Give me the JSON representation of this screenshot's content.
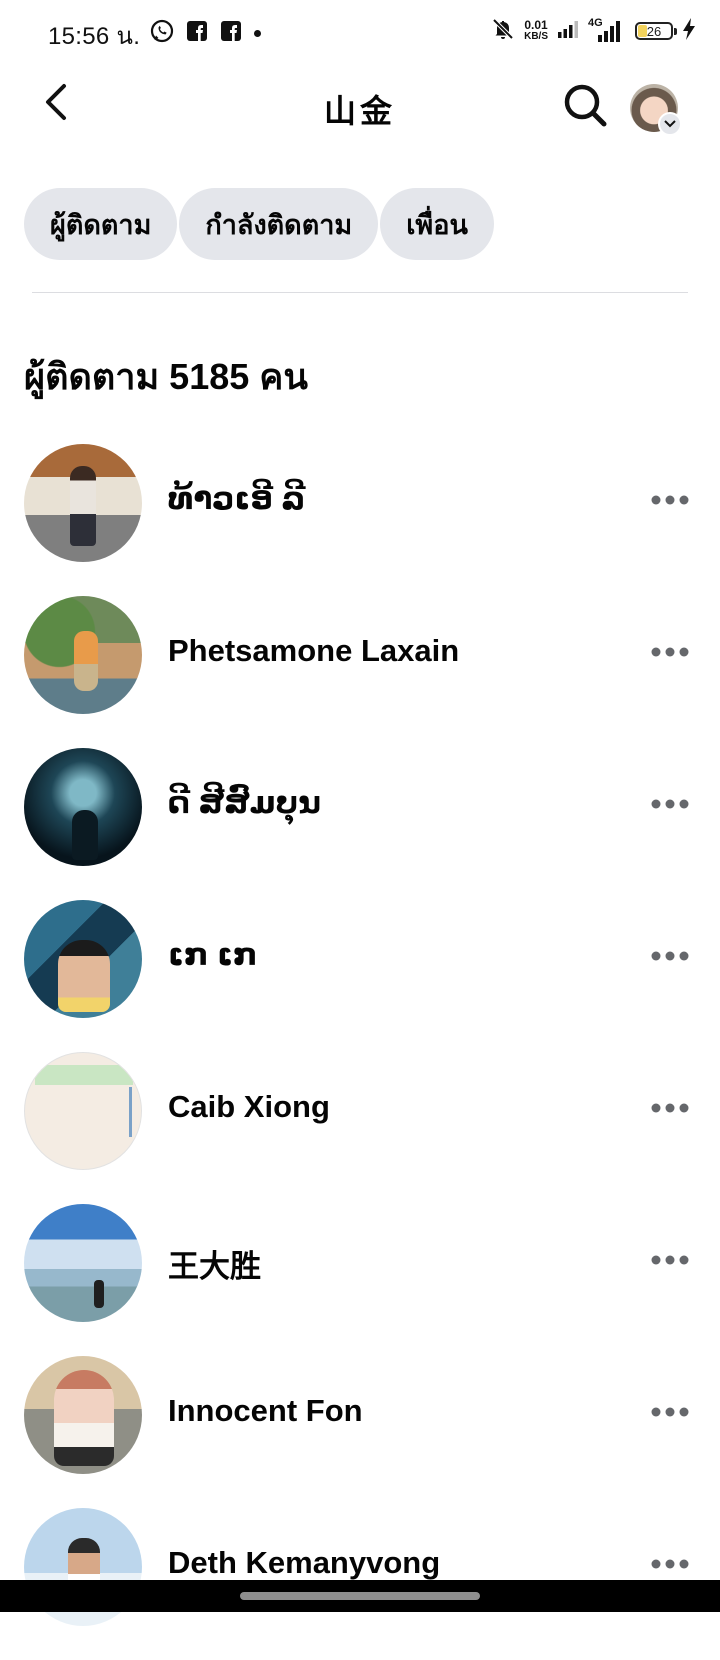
{
  "status_bar": {
    "time": "15:56 น.",
    "net_speed_value": "0.01",
    "net_speed_unit": "KB/S",
    "network_type": "4G",
    "battery_level": "26",
    "battery_fraction": 0.26,
    "icons": [
      "whatsapp-icon",
      "facebook-icon",
      "facebook-icon",
      "notification-dot",
      "bell-off-icon",
      "signal-icon",
      "signal-4g-icon",
      "battery-icon",
      "charging-bolt-icon"
    ]
  },
  "header": {
    "title": "山金",
    "back_icon": "chevron-left-icon",
    "search_icon": "search-icon"
  },
  "tabs": [
    {
      "label": "ผู้ติดตาม"
    },
    {
      "label": "กำลังติดตาม"
    },
    {
      "label": "เพื่อน"
    }
  ],
  "section": {
    "heading": "ผู้ติดตาม 5185 คน"
  },
  "followers": [
    {
      "name": "ທ້າວເອີ ລີ"
    },
    {
      "name": "Phetsamone Laxain"
    },
    {
      "name": "ດີ ສີສົມບຸນ"
    },
    {
      "name": "ເກ ເກ"
    },
    {
      "name": "Caib Xiong"
    },
    {
      "name": "王大胜"
    },
    {
      "name": "Innocent Fon"
    },
    {
      "name": "Deth Kemanyvong"
    }
  ],
  "colors": {
    "chip_bg": "#e4e6eb",
    "text": "#050505",
    "more_dots": "#65676b",
    "battery_fill": "#f3d35c"
  }
}
